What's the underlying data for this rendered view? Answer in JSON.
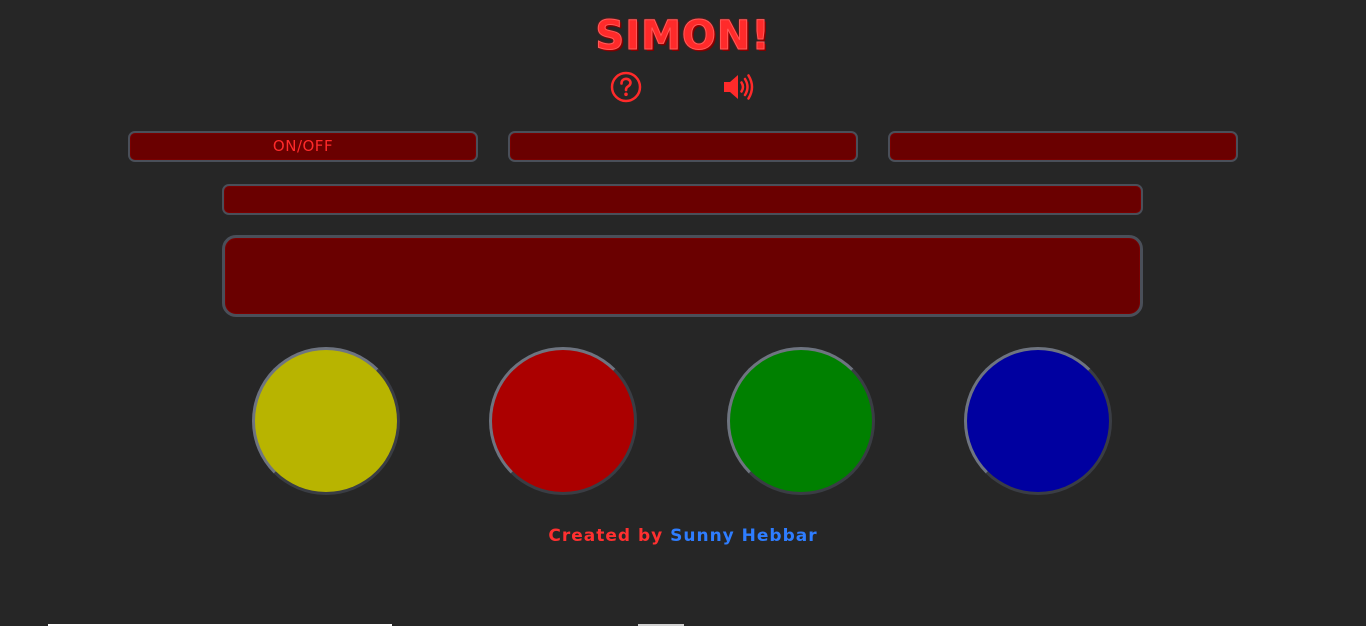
{
  "header": {
    "title": "SIMON!",
    "help_icon": "question-circle-icon",
    "sound_icon": "volume-up-icon"
  },
  "controls": {
    "onoff_label": "ON/OFF",
    "middle_label": "",
    "right_label": ""
  },
  "status": {
    "text": "",
    "display_text": ""
  },
  "pads": [
    {
      "name": "yellow",
      "color": "#b8b400"
    },
    {
      "name": "red",
      "color": "#ab0000"
    },
    {
      "name": "green",
      "color": "#008000"
    },
    {
      "name": "blue",
      "color": "#0000a0"
    }
  ],
  "footer": {
    "prefix": "Created by ",
    "author": "Sunny Hebbar"
  },
  "colors": {
    "background": "#262626",
    "accent": "#ff2a2a",
    "panel": "#6a0000",
    "link": "#2e7dff"
  }
}
